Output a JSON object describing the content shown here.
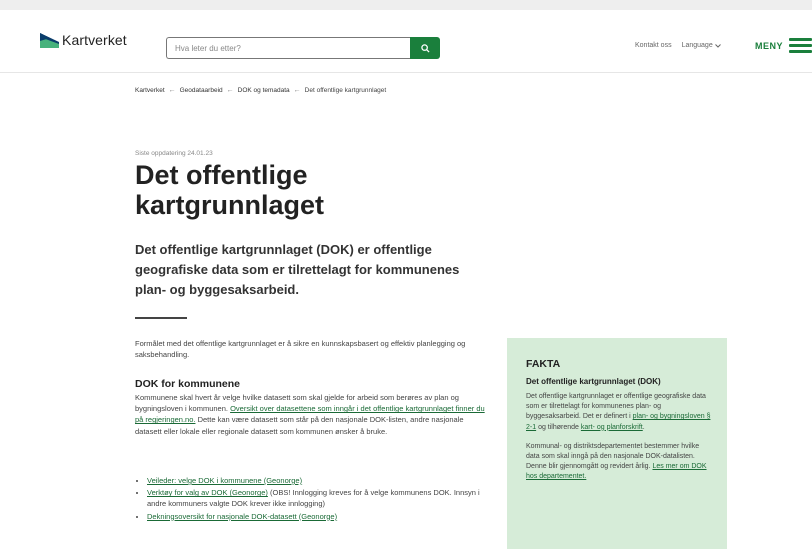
{
  "header": {
    "logo_text": "Kartverket",
    "search_placeholder": "Hva leter du etter?",
    "contact_label": "Kontakt oss",
    "language_label": "Language",
    "menu_label": "MENY"
  },
  "breadcrumb": [
    "Kartverket",
    "Geodataarbeid",
    "DOK og temadata",
    "Det offentlige kartgrunnlaget"
  ],
  "article": {
    "updated": "Siste oppdatering 24.01.23",
    "title_line1": "Det offentlige",
    "title_line2": "kartgrunnlaget",
    "lead": "Det offentlige kartgrunnlaget (DOK) er offentlige geografiske data som er tilrettelagt for kommunenes plan- og byggesaksarbeid.",
    "intro": "Formålet med det offentlige kartgrunnlaget er å sikre en kunnskapsbasert og effektiv planlegging og saksbehandling.",
    "section_heading": "DOK for kommunene",
    "section_text_1": "Kommunene skal hvert år velge hvilke datasett som skal gjelde for arbeid som berøres av plan og bygningsloven i kommunen.",
    "section_link": "Oversikt over datasettene som inngår i det offentlige kartgrunnlaget finner du på regjeringen.no.",
    "section_text_2": "Dette kan være datasett som står på den nasjonale DOK-listen, andre nasjonale datasett eller lokale eller regionale datasett som kommunen ønsker å bruke.",
    "bullets": [
      {
        "link": "Veileder: velge DOK i kommunene (Geonorge)",
        "text": ""
      },
      {
        "link": "Verktøy for valg av DOK (Geonorge)",
        "text": "(OBS! Innlogging kreves for å velge kommunens DOK. Innsyn i andre kommuners valgte DOK krever ikke innlogging)"
      },
      {
        "link": "Dekningsoversikt for nasjonale DOK-datasett (Geonorge)",
        "text": ""
      }
    ]
  },
  "fakta": {
    "heading": "FAKTA",
    "subheading": "Det offentlige kartgrunnlaget (DOK)",
    "p1_text": "Det offentlige kartgrunnlaget er offentlige geografiske data som er tilrettelagt for kommunenes plan- og byggesaksarbeid. Det er definert i",
    "p1_link1": "plan- og bygningsloven § 2-1",
    "p1_mid": "og tilhørende",
    "p1_link2": "kart- og planforskrift",
    "p1_end": ".",
    "p2_text": "Kommunal- og distriktsdepartementet bestemmer hvilke data som skal inngå på den nasjonale DOK-datalisten. Denne blir gjennomgått og revidert årlig.",
    "p2_link": "Les mer om DOK hos departementet."
  },
  "colors": {
    "brand_green": "#1a7f3c",
    "fakta_bg": "#d6ecd8",
    "logo_blue": "#0a3d6b",
    "logo_green": "#47b27c"
  },
  "icons": [
    "kartverket-logo-icon",
    "search-icon",
    "chevron-down-icon",
    "hamburger-menu-icon"
  ]
}
